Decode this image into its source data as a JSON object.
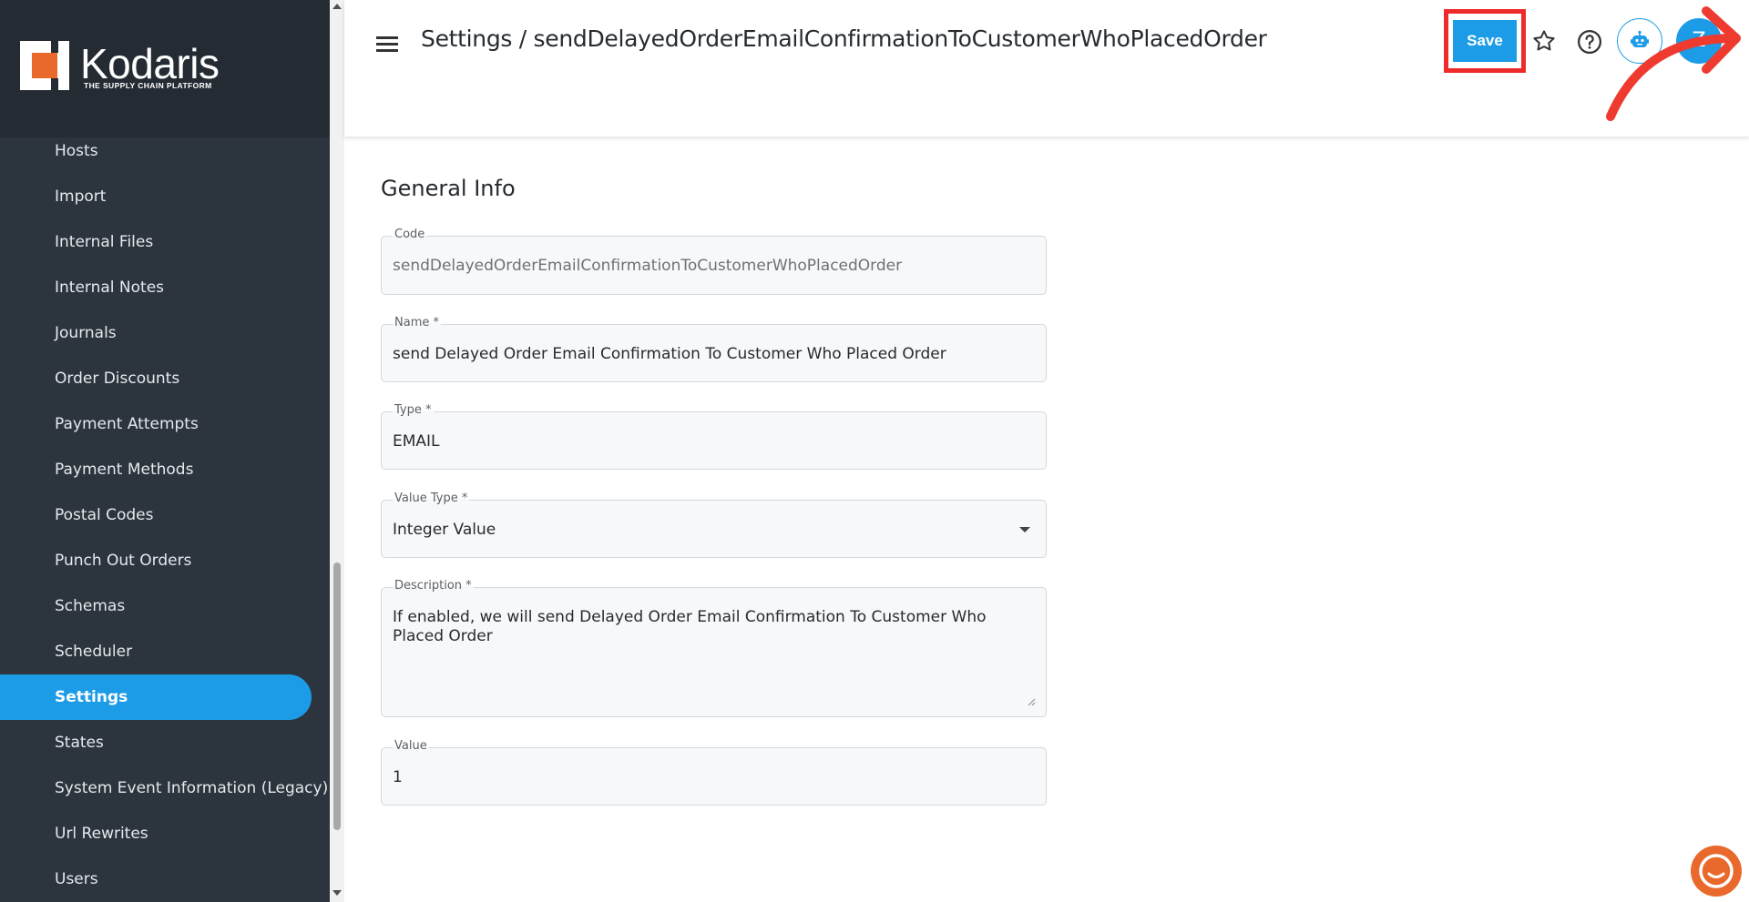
{
  "sidebar": {
    "logo": {
      "wordmark": "Kodaris",
      "tagline": "THE SUPPLY CHAIN PLATFORM"
    },
    "items": [
      {
        "label": "Hosts"
      },
      {
        "label": "Import"
      },
      {
        "label": "Internal Files"
      },
      {
        "label": "Internal Notes"
      },
      {
        "label": "Journals"
      },
      {
        "label": "Order Discounts"
      },
      {
        "label": "Payment Attempts"
      },
      {
        "label": "Payment Methods"
      },
      {
        "label": "Postal Codes"
      },
      {
        "label": "Punch Out Orders"
      },
      {
        "label": "Schemas"
      },
      {
        "label": "Scheduler"
      },
      {
        "label": "Settings",
        "active": true
      },
      {
        "label": "States"
      },
      {
        "label": "System Event Information (Legacy)"
      },
      {
        "label": "Url Rewrites"
      },
      {
        "label": "Users"
      }
    ]
  },
  "header": {
    "title": "Settings / sendDelayedOrderEmailConfirmationToCustomerWhoPlacedOrder",
    "save_label": "Save",
    "avatar_initial": "Z",
    "icons": [
      "menu-icon",
      "star-icon",
      "help-icon",
      "robot-icon"
    ]
  },
  "form": {
    "section_title": "General Info",
    "code": {
      "label": "Code",
      "value": "sendDelayedOrderEmailConfirmationToCustomerWhoPlacedOrder"
    },
    "name": {
      "label": "Name *",
      "value": "send Delayed Order Email Confirmation To Customer Who Placed Order"
    },
    "type": {
      "label": "Type *",
      "value": "EMAIL"
    },
    "value_type": {
      "label": "Value Type *",
      "value": "Integer Value"
    },
    "description": {
      "label": "Description *",
      "value": "If enabled, we will send Delayed Order Email Confirmation To Customer Who Placed Order"
    },
    "value": {
      "label": "Value",
      "value": "1"
    }
  },
  "colors": {
    "sidebar_bg": "#2c343d",
    "accent": "#1c9be6",
    "highlight": "#ee2b2b",
    "brand_orange": "#e8692b"
  }
}
